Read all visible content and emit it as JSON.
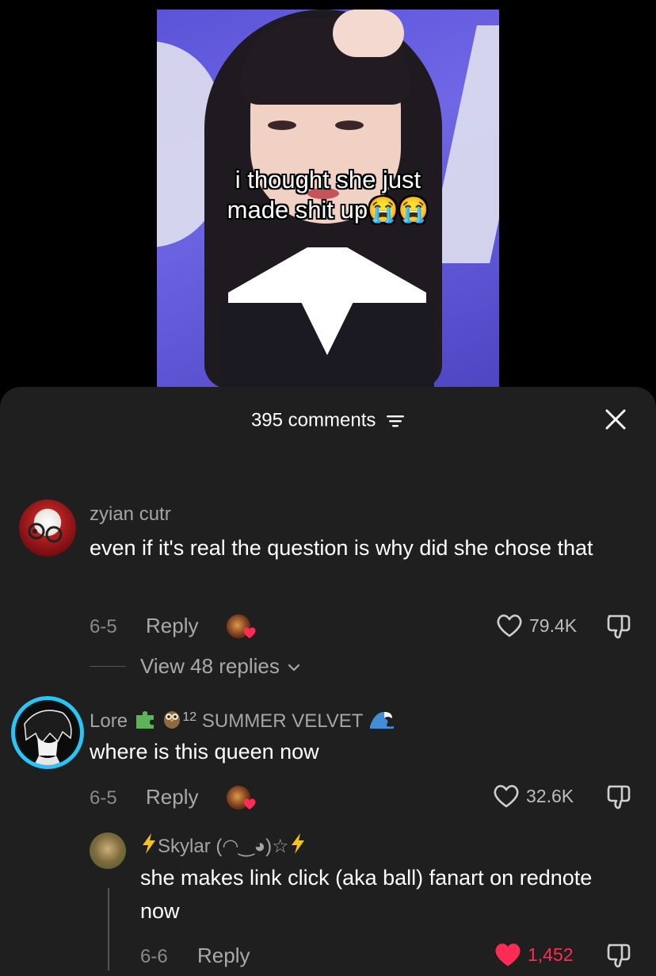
{
  "video": {
    "caption_line1": "i thought she just",
    "caption_line2": "made shit up😭😭"
  },
  "comments_header": {
    "count_label": "395 comments"
  },
  "comments": [
    {
      "username": "zyian cutr",
      "text": "even if it's real the question is why did she chose that",
      "date": "6-5",
      "reply_label": "Reply",
      "likes": "79.4K",
      "view_replies": "View 48 replies"
    },
    {
      "username": "Lore",
      "username_suffix": "12",
      "username_tag": "SUMMER VELVET",
      "text": "where is this queen now",
      "date": "6-5",
      "reply_label": "Reply",
      "likes": "32.6K"
    },
    {
      "username": "Skylar (◠‿◕)☆",
      "text": "she makes link click (aka ball) fanart on rednote now",
      "date": "6-6",
      "reply_label": "Reply",
      "likes": "1,452",
      "liked": true
    }
  ],
  "colors": {
    "sheet_bg": "#1f1f1f",
    "liked_red": "#fe2c55",
    "muted_text": "#a5a5a5",
    "lore_ring": "#29c5f6"
  },
  "icons": [
    "filter-icon",
    "close-icon",
    "heart-icon",
    "dislike-icon",
    "chevron-down-icon",
    "puzzle-icon",
    "owl-icon",
    "wave-icon",
    "lightning-icon"
  ]
}
